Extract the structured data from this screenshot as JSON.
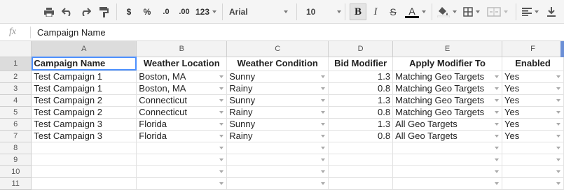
{
  "toolbar": {
    "number_format_label": "123",
    "currency_label": "$",
    "percent_label": "%",
    "decrease_decimals_label": ".0",
    "increase_decimals_label": ".00",
    "font_name": "Arial",
    "font_size": "10",
    "bold_label": "B",
    "italic_label": "I",
    "strike_label": "S",
    "text_color_label": "A"
  },
  "formula_bar": {
    "fx_label": "fx",
    "value": "Campaign Name"
  },
  "grid": {
    "columns": [
      "A",
      "B",
      "C",
      "D",
      "E",
      "F"
    ],
    "row_numbers": [
      "1",
      "2",
      "3",
      "4",
      "5",
      "6",
      "7",
      "8",
      "9",
      "10",
      "11"
    ],
    "header_row": [
      "Campaign Name",
      "Weather Location",
      "Weather Condition",
      "Bid Modifier",
      "Apply Modifier To",
      "Enabled"
    ],
    "rows": [
      [
        "Test Campaign 1",
        "Boston, MA",
        "Sunny",
        "1.3",
        "Matching Geo Targets",
        "Yes"
      ],
      [
        "Test Campaign 1",
        "Boston, MA",
        "Rainy",
        "0.8",
        "Matching Geo Targets",
        "Yes"
      ],
      [
        "Test Campaign 2",
        "Connecticut",
        "Sunny",
        "1.3",
        "Matching Geo Targets",
        "Yes"
      ],
      [
        "Test Campaign 2",
        "Connecticut",
        "Rainy",
        "0.8",
        "Matching Geo Targets",
        "Yes"
      ],
      [
        "Test Campaign 3",
        "Florida",
        "Sunny",
        "1.3",
        "All Geo Targets",
        "Yes"
      ],
      [
        "Test Campaign 3",
        "Florida",
        "Rainy",
        "0.8",
        "All Geo Targets",
        "Yes"
      ]
    ]
  },
  "colors": {
    "selection_outline": "#4d90fe",
    "header_bg": "#f3f3f3",
    "toolbar_bg": "#f5f5f5"
  }
}
